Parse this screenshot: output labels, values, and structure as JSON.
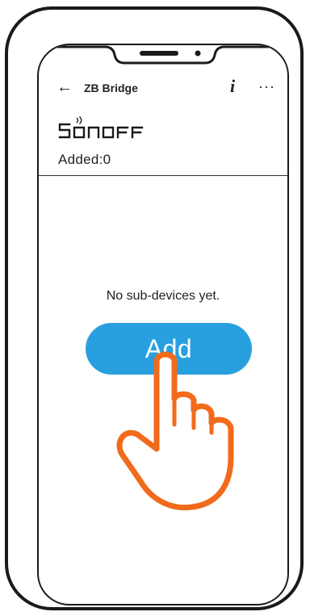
{
  "header": {
    "back_icon": "←",
    "title": "ZB Bridge",
    "info_icon": "i",
    "more_icon": "···"
  },
  "brand": {
    "logo_text": "SONOFF"
  },
  "status": {
    "added_text": "Added:0"
  },
  "main": {
    "empty_text": "No sub-devices  yet.",
    "add_button_label": "Add"
  },
  "colors": {
    "accent": "#28a0e0",
    "hand_stroke": "#f26a1b"
  },
  "icons": [
    "arrow-left-icon",
    "info-icon",
    "more-icon",
    "hand-pointer-icon"
  ]
}
